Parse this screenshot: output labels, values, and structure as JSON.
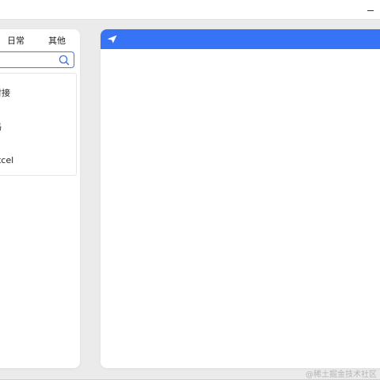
{
  "window": {
    "minimize_icon": "minimize-icon"
  },
  "left_panel": {
    "tabs": [
      {
        "label": "日常"
      },
      {
        "label": "其他"
      }
    ],
    "search": {
      "value": "",
      "placeholder": "",
      "icon": "search-icon"
    },
    "results": [
      {
        "label": "对接"
      },
      {
        "label": "码"
      },
      {
        "label": "Excel"
      }
    ]
  },
  "right_panel": {
    "header_icon": "send-icon",
    "header_color": "#3673f5"
  },
  "watermark": "@稀土掘金技术社区"
}
